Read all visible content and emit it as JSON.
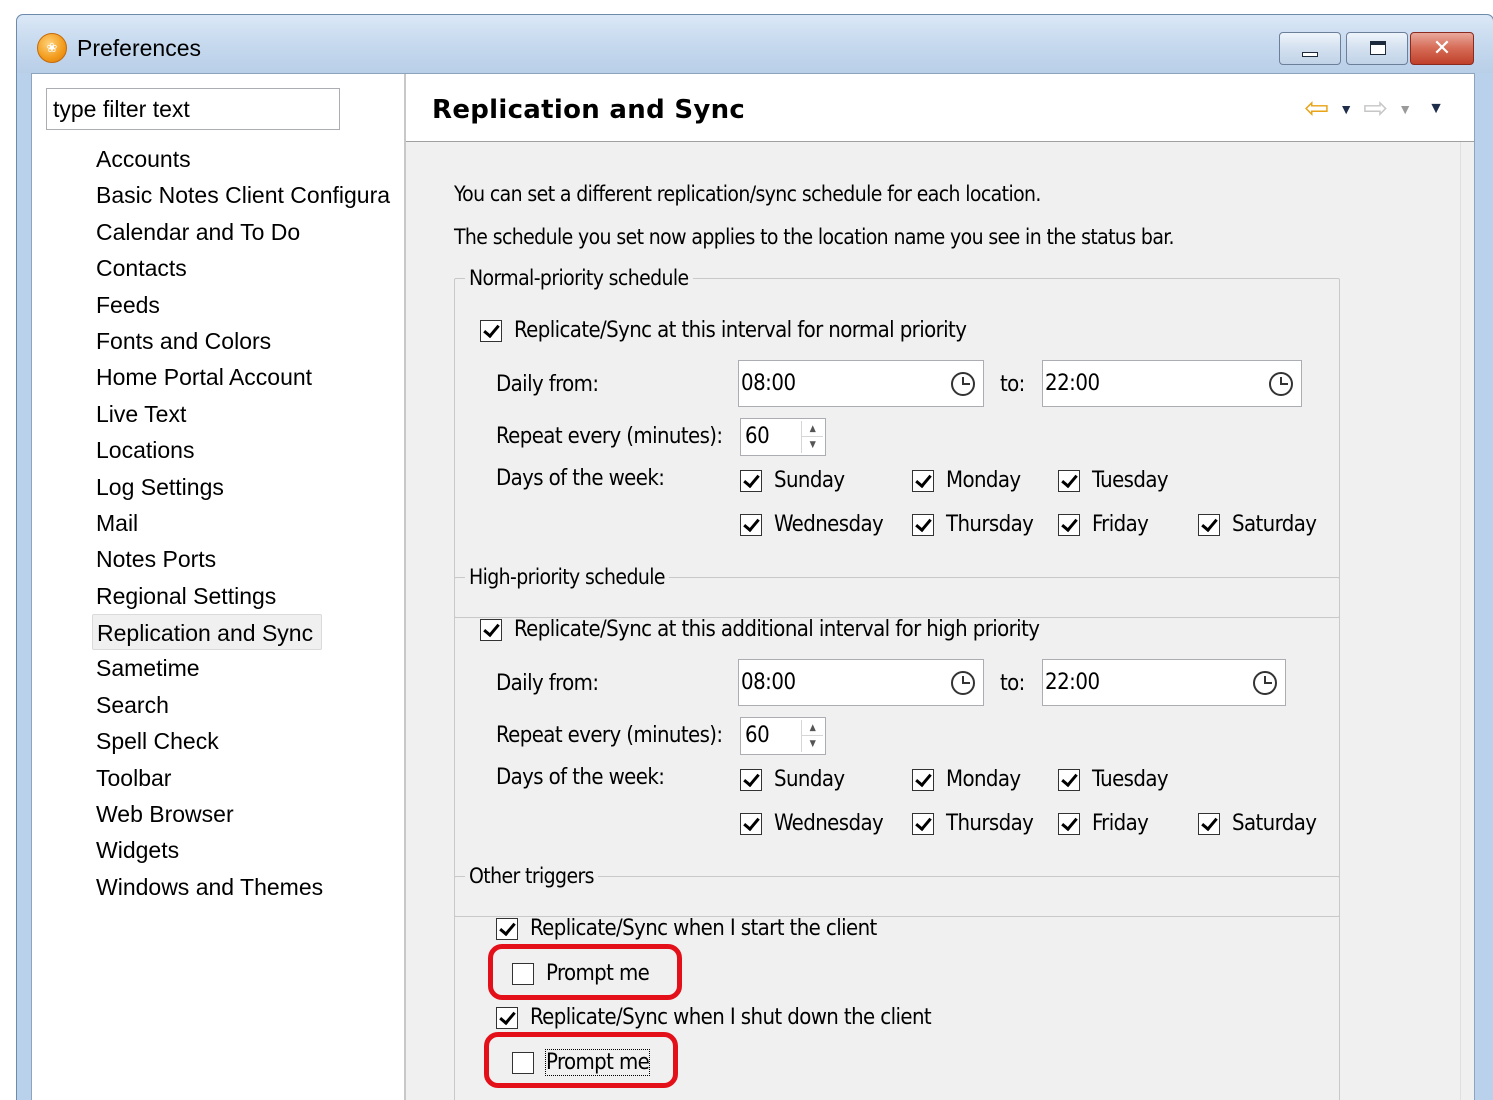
{
  "window": {
    "title": "Preferences",
    "icon": "lotus-notes-icon"
  },
  "nav": {
    "filter_placeholder": "type filter text",
    "items": [
      "Accounts",
      "Basic Notes Client Configura",
      "Calendar and To Do",
      "Contacts",
      "Feeds",
      "Fonts and Colors",
      "Home Portal Account",
      "Live Text",
      "Locations",
      "Log Settings",
      "Mail",
      "Notes Ports",
      "Regional Settings",
      "Replication and Sync",
      "Sametime",
      "Search",
      "Spell Check",
      "Toolbar",
      "Web Browser",
      "Widgets",
      "Windows and Themes"
    ],
    "selected": "Replication and Sync"
  },
  "page": {
    "title": "Replication and Sync",
    "intro_line1": "You can set a different replication/sync schedule for each location.",
    "intro_line2": "The schedule you set now applies to the location name you see in the status bar."
  },
  "normal": {
    "legend": "Normal-priority schedule",
    "enable_label": "Replicate/Sync at this interval for normal priority",
    "enabled": true,
    "daily_from_label": "Daily from:",
    "from_value": "08:00",
    "to_label": "to:",
    "to_value": "22:00",
    "repeat_label": "Repeat every (minutes):",
    "repeat_value": "60",
    "days_label": "Days of the week:",
    "days": {
      "sunday": "Sunday",
      "monday": "Monday",
      "tuesday": "Tuesday",
      "wednesday": "Wednesday",
      "thursday": "Thursday",
      "friday": "Friday",
      "saturday": "Saturday"
    }
  },
  "high": {
    "legend": "High-priority schedule",
    "enable_label": "Replicate/Sync at this additional interval for high priority",
    "enabled": true,
    "daily_from_label": "Daily from:",
    "from_value": "08:00",
    "to_label": "to:",
    "to_value": "22:00",
    "repeat_label": "Repeat every (minutes):",
    "repeat_value": "60",
    "days_label": "Days of the week:",
    "days": {
      "sunday": "Sunday",
      "monday": "Monday",
      "tuesday": "Tuesday",
      "wednesday": "Wednesday",
      "thursday": "Thursday",
      "friday": "Friday",
      "saturday": "Saturday"
    }
  },
  "other": {
    "legend": "Other triggers",
    "start_label": "Replicate/Sync when I start the client",
    "start_checked": true,
    "start_prompt_label": "Prompt me",
    "start_prompt_checked": false,
    "shutdown_label": "Replicate/Sync when I shut down the client",
    "shutdown_checked": true,
    "shutdown_prompt_label": "Prompt me",
    "shutdown_prompt_checked": false
  },
  "colors": {
    "highlight": "#e3101a",
    "back_arrow": "#e8a317"
  }
}
